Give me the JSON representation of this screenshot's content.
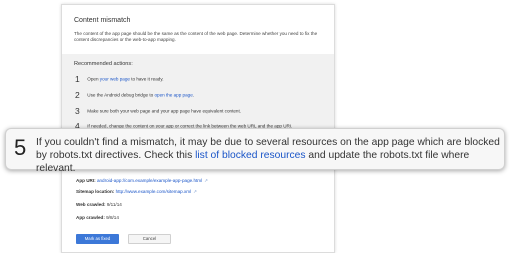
{
  "card": {
    "title": "Content mismatch",
    "description": "The content of the app page should be the same as the content of the web page. Determine whether you need to fix the content discrepancies or the web-to-app mapping."
  },
  "actions": {
    "title": "Recommended actions:",
    "steps": [
      {
        "num": "1",
        "pre": "Open ",
        "link": "your web page",
        "post": " to have it ready."
      },
      {
        "num": "2",
        "pre": "Use the Android debug bridge to ",
        "link": "open the app page",
        "post": "."
      },
      {
        "num": "3",
        "pre": "Make sure both your web page and your app page have equivalent content.",
        "link": "",
        "post": ""
      },
      {
        "num": "4",
        "pre": "If needed, change the content on your app or correct the link between the web URL and the app URI.",
        "link": "",
        "post": ""
      }
    ]
  },
  "callout": {
    "num": "5",
    "pre": "If you couldn't find a mismatch, it may be due to several resources on the app page which are blocked by robots.txt directives. Check this ",
    "link": "list of blocked resources",
    "post": " and update the robots.txt file where relevant."
  },
  "meta": {
    "app_uri_label": "App URI:",
    "app_uri_value": "android-app://com.example/example-app-page.html",
    "sitemap_label": "Sitemap location:",
    "sitemap_value": "http://www.example.com/sitemap.xml",
    "web_crawled_label": "Web crawled:",
    "web_crawled_value": "9/11/14",
    "app_crawled_label": "App crawled:",
    "app_crawled_value": "9/8/14",
    "external_icon": "external-link-icon"
  },
  "buttons": {
    "fixed": "Mark as fixed",
    "cancel": "Cancel"
  },
  "colors": {
    "link": "#1a55c8",
    "primary_button": "#3c78d8",
    "actions_bg": "#f1f1f1"
  }
}
